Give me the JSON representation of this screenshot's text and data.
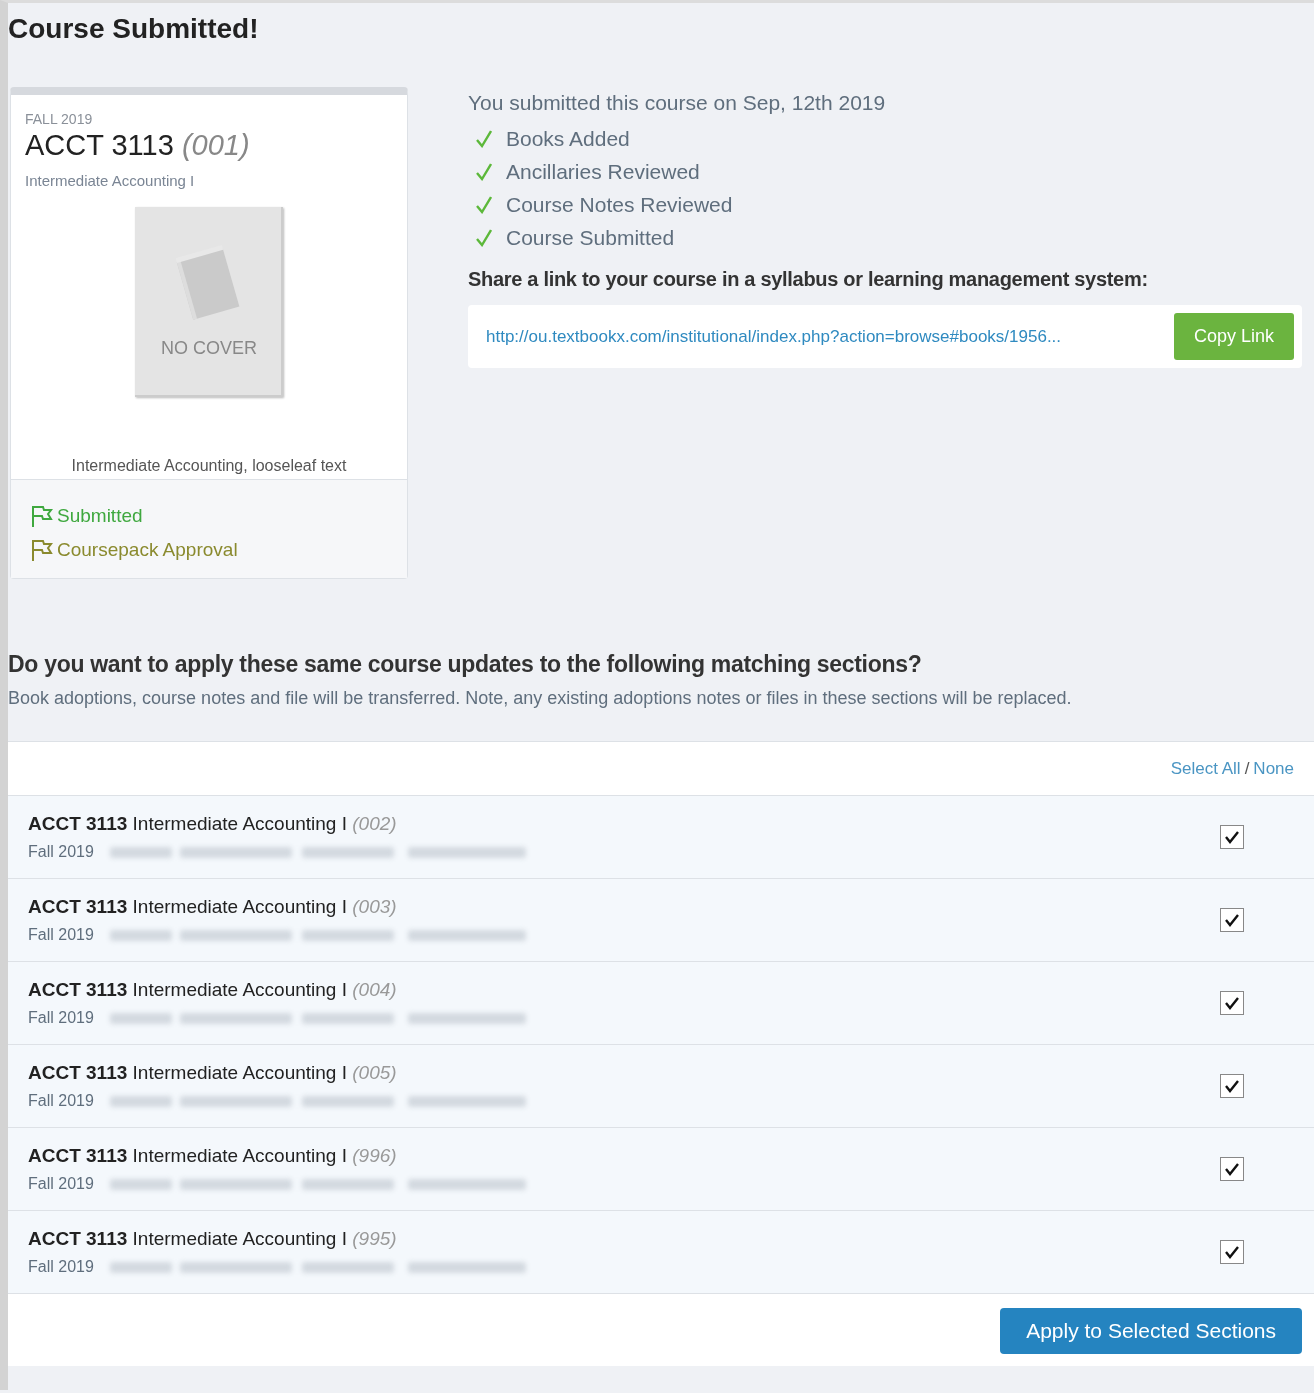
{
  "page_title": "Course Submitted!",
  "course_card": {
    "term": "FALL 2019",
    "code": "ACCT 3113",
    "section": "(001)",
    "name": "Intermediate Accounting I",
    "cover_label": "NO COVER",
    "book_title": "Intermediate Accounting, looseleaf text",
    "statuses": [
      {
        "label": "Submitted",
        "color": "#3fa83f"
      },
      {
        "label": "Coursepack Approval",
        "color": "#8a8a2e"
      }
    ]
  },
  "summary": {
    "submitted_text": "You submitted this course on Sep, 12th 2019",
    "checklist": [
      {
        "label": "Books Added",
        "done": true
      },
      {
        "label": "Ancillaries Reviewed",
        "done": true
      },
      {
        "label": "Course Notes Reviewed",
        "done": true
      },
      {
        "label": "Course Submitted",
        "done": true
      }
    ],
    "share_heading": "Share a link to your course in a syllabus or learning management system:",
    "share_link": "http://ou.textbookx.com/institutional/index.php?action=browse#books/1956...",
    "copy_button": "Copy Link"
  },
  "matching": {
    "heading": "Do you want to apply these same course updates to the following matching sections?",
    "note": "Book adoptions, course notes and file will be transferred. Note, any existing adoptions notes or files in these sections will be replaced.",
    "select_all": "Select All",
    "separator": "/",
    "select_none": "None",
    "sections": [
      {
        "code": "ACCT 3113",
        "title": "Intermediate Accounting I",
        "section": "(002)",
        "term": "Fall 2019",
        "checked": true
      },
      {
        "code": "ACCT 3113",
        "title": "Intermediate Accounting I",
        "section": "(003)",
        "term": "Fall 2019",
        "checked": true
      },
      {
        "code": "ACCT 3113",
        "title": "Intermediate Accounting I",
        "section": "(004)",
        "term": "Fall 2019",
        "checked": true
      },
      {
        "code": "ACCT 3113",
        "title": "Intermediate Accounting I",
        "section": "(005)",
        "term": "Fall 2019",
        "checked": true
      },
      {
        "code": "ACCT 3113",
        "title": "Intermediate Accounting I",
        "section": "(996)",
        "term": "Fall 2019",
        "checked": true
      },
      {
        "code": "ACCT 3113",
        "title": "Intermediate Accounting I",
        "section": "(995)",
        "term": "Fall 2019",
        "checked": true
      }
    ],
    "apply_button": "Apply to Selected Sections"
  }
}
